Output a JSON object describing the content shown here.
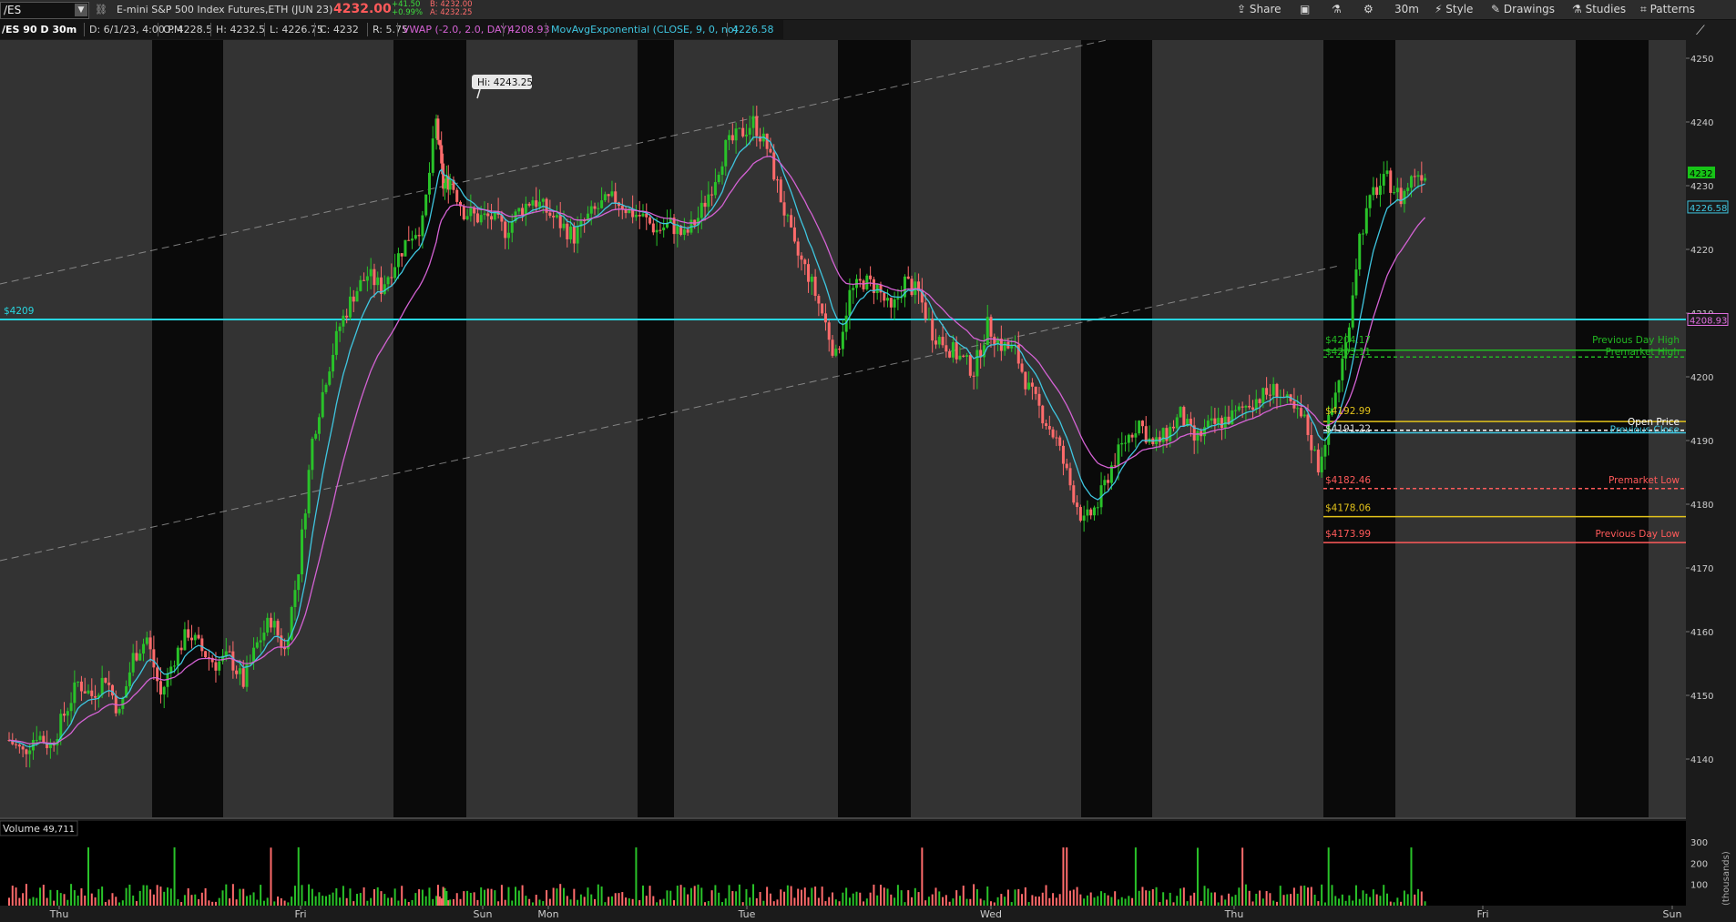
{
  "toolbar": {
    "symbol": "/ES",
    "description": "E-mini S&P 500 Index Futures,ETH (JUN 23)",
    "last_price": "4232.00",
    "net_change": "+41.50",
    "net_change_pct": "+0.99%",
    "bid": "B: 4232.00",
    "ask": "A: 4232.25",
    "buttons": {
      "share": "Share",
      "timeframe": "30m",
      "style": "Style",
      "drawings": "Drawings",
      "studies": "Studies",
      "patterns": "Patterns"
    }
  },
  "infobar": {
    "chart_name": "/ES 90 D 30m",
    "date": "D: 6/1/23, 4:00 PM",
    "open": "O: 4228.5",
    "high": "H: 4232.5",
    "low": "L: 4226.75",
    "close": "C: 4232",
    "range": "R: 5.75",
    "vwap_label": "VWAP (-2.0, 2.0, DAY)",
    "vwap_value": "4208.93",
    "ema_label": "MovAvgExponential (CLOSE, 9, 0, no)",
    "ema_value": "4226.58"
  },
  "volume_panel": {
    "label": "Volume",
    "value": "49,711",
    "axis_unit": "(thousands)"
  },
  "colors": {
    "up": "#29c229",
    "down": "#ff6b6b",
    "ema": "#3fc6e0",
    "vwap": "#d462d4",
    "hline": "#28d6e0",
    "session_dark": "#0a0a0a",
    "session_light": "#333333"
  },
  "chart_data": {
    "type": "line",
    "series_description": "candlestick price chart with volume",
    "x_ticks": [
      "Thu",
      "Fri",
      "Sun",
      "Mon",
      "Tue",
      "Wed",
      "Thu",
      "Fri",
      "Sun"
    ],
    "y_ticks": [
      4140,
      4150,
      4160,
      4170,
      4180,
      4190,
      4200,
      4210,
      4220,
      4230,
      4240,
      4250
    ],
    "ylim": [
      4133,
      4255
    ],
    "volume_ticks": [
      "100",
      "200",
      "300"
    ],
    "price_path": [
      [
        0,
        4143
      ],
      [
        10,
        4141
      ],
      [
        20,
        4144
      ],
      [
        30,
        4142
      ],
      [
        40,
        4147
      ],
      [
        50,
        4152
      ],
      [
        60,
        4150
      ],
      [
        70,
        4153
      ],
      [
        80,
        4147
      ],
      [
        90,
        4156
      ],
      [
        100,
        4159
      ],
      [
        110,
        4150
      ],
      [
        120,
        4156
      ],
      [
        130,
        4160
      ],
      [
        140,
        4157
      ],
      [
        150,
        4155
      ],
      [
        160,
        4156
      ],
      [
        170,
        4152
      ],
      [
        180,
        4158
      ],
      [
        190,
        4162
      ],
      [
        200,
        4157
      ],
      [
        210,
        4170
      ],
      [
        220,
        4190
      ],
      [
        230,
        4200
      ],
      [
        240,
        4208
      ],
      [
        250,
        4213
      ],
      [
        260,
        4216
      ],
      [
        270,
        4214
      ],
      [
        280,
        4218
      ],
      [
        290,
        4222
      ],
      [
        300,
        4224
      ],
      [
        310,
        4240
      ],
      [
        315,
        4230
      ],
      [
        320,
        4231
      ],
      [
        330,
        4226
      ],
      [
        340,
        4225
      ],
      [
        350,
        4225
      ],
      [
        360,
        4223
      ],
      [
        370,
        4226
      ],
      [
        380,
        4228
      ],
      [
        390,
        4226
      ],
      [
        400,
        4224
      ],
      [
        410,
        4222
      ],
      [
        420,
        4225
      ],
      [
        430,
        4227
      ],
      [
        440,
        4228
      ],
      [
        450,
        4226
      ],
      [
        460,
        4225
      ],
      [
        470,
        4223
      ],
      [
        480,
        4224
      ],
      [
        490,
        4222
      ],
      [
        500,
        4225
      ],
      [
        510,
        4230
      ],
      [
        520,
        4236
      ],
      [
        530,
        4238
      ],
      [
        540,
        4240
      ],
      [
        550,
        4236
      ],
      [
        560,
        4228
      ],
      [
        570,
        4220
      ],
      [
        580,
        4216
      ],
      [
        590,
        4210
      ],
      [
        600,
        4203
      ],
      [
        610,
        4213
      ],
      [
        620,
        4215
      ],
      [
        630,
        4214
      ],
      [
        640,
        4210
      ],
      [
        650,
        4215
      ],
      [
        660,
        4213
      ],
      [
        670,
        4207
      ],
      [
        680,
        4205
      ],
      [
        690,
        4203
      ],
      [
        700,
        4201
      ],
      [
        710,
        4208
      ],
      [
        720,
        4205
      ],
      [
        730,
        4204
      ],
      [
        740,
        4198
      ],
      [
        750,
        4194
      ],
      [
        760,
        4190
      ],
      [
        770,
        4183
      ],
      [
        780,
        4177
      ],
      [
        790,
        4180
      ],
      [
        800,
        4186
      ],
      [
        810,
        4190
      ],
      [
        820,
        4193
      ],
      [
        830,
        4189
      ],
      [
        840,
        4191
      ],
      [
        850,
        4194
      ],
      [
        860,
        4190
      ],
      [
        870,
        4192
      ],
      [
        880,
        4193
      ],
      [
        890,
        4194
      ],
      [
        900,
        4196
      ],
      [
        910,
        4197
      ],
      [
        920,
        4198
      ],
      [
        930,
        4195
      ],
      [
        940,
        4193
      ],
      [
        950,
        4186
      ],
      [
        960,
        4195
      ],
      [
        970,
        4205
      ],
      [
        980,
        4222
      ],
      [
        990,
        4229
      ],
      [
        1000,
        4231
      ],
      [
        1010,
        4228
      ],
      [
        1020,
        4232
      ]
    ],
    "annotations": [
      {
        "label": "Hi: 4243.25"
      },
      {
        "label": "$4209",
        "y": 4209
      },
      {
        "label": "$4204.17",
        "y": 4204.17
      },
      {
        "label": "$4203.11",
        "y": 4203.11
      },
      {
        "label": "Previous Day High",
        "y": 4204.17
      },
      {
        "label": "Premarket High",
        "y": 4203.11
      },
      {
        "label": "$4192.99",
        "y": 4192.99
      },
      {
        "label": "$4191.22",
        "y": 4191.22
      },
      {
        "label": "Open Price",
        "y": 4192.99
      },
      {
        "label": "Previous Close",
        "y": 4191.22
      },
      {
        "label": "$4182.46",
        "y": 4182.46
      },
      {
        "label": "Premarket Low",
        "y": 4182.46
      },
      {
        "label": "$4178.06",
        "y": 4178.06
      },
      {
        "label": "$4173.99",
        "y": 4173.99
      },
      {
        "label": "Previous Day Low",
        "y": 4173.99
      }
    ],
    "right_labels": [
      {
        "text": "4232",
        "y": 4232
      },
      {
        "text": "4226.58",
        "y": 4226.58
      },
      {
        "text": "4208.93",
        "y": 4208.93
      }
    ]
  }
}
